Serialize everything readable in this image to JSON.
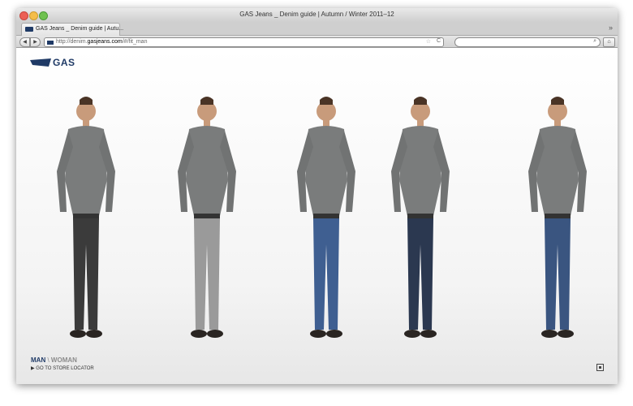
{
  "window": {
    "title": "GAS Jeans _ Denim guide | Autumn / Winter 2011–12"
  },
  "tabs": [
    {
      "label": "GAS Jeans _ Denim guide | Autu..."
    }
  ],
  "address": {
    "url_prefix": "http://denim.",
    "url_domain": "gasjeans.com",
    "url_path": "/#/fit_man"
  },
  "toolbar": {
    "back_glyph": "◀",
    "forward_glyph": "▶",
    "home_glyph": "⌂",
    "star_glyph": "☆",
    "reload_glyph": "C",
    "search_glyph": "⌕",
    "new_tab_glyph": "»"
  },
  "brand": {
    "logo_text": "GAS",
    "color": "#1f3a66"
  },
  "models": [
    {
      "id": "model-1",
      "jeans": "dark grey washed",
      "jeans_color": "#3b3b3b"
    },
    {
      "id": "model-2",
      "jeans": "light grey washed",
      "jeans_color": "#9a9a9a"
    },
    {
      "id": "model-3",
      "jeans": "mid blue destroyed",
      "jeans_color": "#3f5f91"
    },
    {
      "id": "model-4",
      "jeans": "dark rinse",
      "jeans_color": "#2b3850"
    },
    {
      "id": "model-5",
      "jeans": "mid blue worn",
      "jeans_color": "#3a5580"
    }
  ],
  "footer": {
    "man_label": "MAN",
    "separator": "\\",
    "woman_label": "WOMAN",
    "store_link": "GO TO STORE LOCATOR",
    "store_arrow": "▶"
  }
}
